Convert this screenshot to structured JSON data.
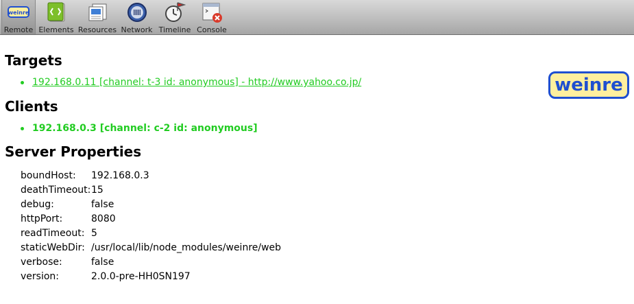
{
  "toolbar": {
    "items": [
      {
        "label": "Remote",
        "icon": "weinre-logo-icon",
        "selected": true
      },
      {
        "label": "Elements",
        "icon": "elements-icon"
      },
      {
        "label": "Resources",
        "icon": "resources-icon"
      },
      {
        "label": "Network",
        "icon": "network-icon"
      },
      {
        "label": "Timeline",
        "icon": "timeline-icon"
      },
      {
        "label": "Console",
        "icon": "console-icon"
      }
    ],
    "remote_logo_text": "weinre"
  },
  "targets": {
    "heading": "Targets",
    "items": [
      {
        "text": "192.168.0.11 [channel: t-3 id: anonymous] - http://www.yahoo.co.jp/"
      }
    ]
  },
  "clients": {
    "heading": "Clients",
    "items": [
      {
        "text": "192.168.0.3 [channel: c-2 id: anonymous]"
      }
    ]
  },
  "server_properties": {
    "heading": "Server Properties",
    "rows": [
      {
        "key": "boundHost:",
        "value": "192.168.0.3"
      },
      {
        "key": "deathTimeout:",
        "value": "15"
      },
      {
        "key": "debug:",
        "value": "false"
      },
      {
        "key": "httpPort:",
        "value": "8080"
      },
      {
        "key": "readTimeout:",
        "value": "5"
      },
      {
        "key": "staticWebDir:",
        "value": "/usr/local/lib/node_modules/weinre/web"
      },
      {
        "key": "verbose:",
        "value": "false"
      },
      {
        "key": "version:",
        "value": "2.0.0-pre-HH0SN197"
      }
    ]
  },
  "logo": {
    "text": "weinre"
  },
  "colors": {
    "link_green": "#22cc22",
    "logo_blue": "#1f4fd0",
    "logo_fill": "#ffef9e"
  }
}
